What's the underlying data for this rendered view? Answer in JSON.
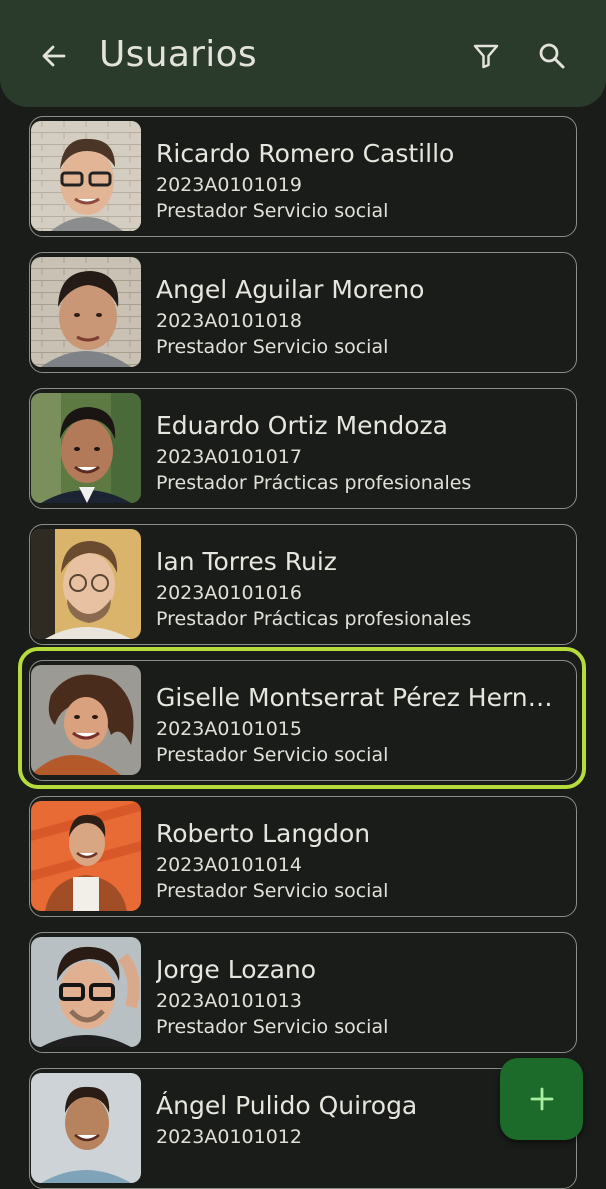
{
  "app_bar": {
    "title": "Usuarios",
    "back_icon": "arrow-left-icon",
    "filter_icon": "filter-icon",
    "search_icon": "search-icon",
    "background": "#2a3a2b"
  },
  "users": [
    {
      "name": "Ricardo Romero Castillo",
      "code": "2023A0101019",
      "role": "Prestador Servicio social"
    },
    {
      "name": "Angel Aguilar Moreno",
      "code": "2023A0101018",
      "role": "Prestador Servicio social"
    },
    {
      "name": "Eduardo Ortiz Mendoza",
      "code": "2023A0101017",
      "role": "Prestador Prácticas profesionales"
    },
    {
      "name": "Ian Torres Ruiz",
      "code": "2023A0101016",
      "role": "Prestador Prácticas profesionales"
    },
    {
      "name": "Giselle Montserrat Pérez Hern…",
      "code": "2023A0101015",
      "role": "Prestador Servicio social",
      "selected": true
    },
    {
      "name": "Roberto Langdon",
      "code": "2023A0101014",
      "role": "Prestador Servicio social"
    },
    {
      "name": "Jorge Lozano",
      "code": "2023A0101013",
      "role": "Prestador Servicio social"
    },
    {
      "name": "Ángel Pulido Quiroga",
      "code": "2023A0101012",
      "role": ""
    }
  ],
  "fab": {
    "icon": "plus-icon",
    "color": "#1d6b2b"
  },
  "colors": {
    "selection_ring": "#b5dc3a",
    "card_border": "#8a8f87",
    "background": "#1a1c19"
  }
}
